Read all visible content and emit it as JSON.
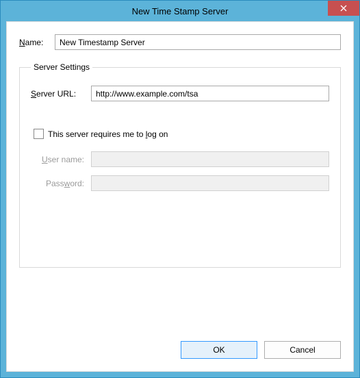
{
  "window": {
    "title": "New Time Stamp Server"
  },
  "labels": {
    "name": "Name:",
    "server_settings": "Server Settings",
    "server_url": "Server URL:",
    "logon_checkbox": "This server requires me to log on",
    "user_name": "User name:",
    "password": "Password:"
  },
  "values": {
    "name": "New Timestamp Server",
    "server_url": "http://www.example.com/tsa",
    "logon_checked": false,
    "user_name": "",
    "password": ""
  },
  "buttons": {
    "ok": "OK",
    "cancel": "Cancel"
  }
}
